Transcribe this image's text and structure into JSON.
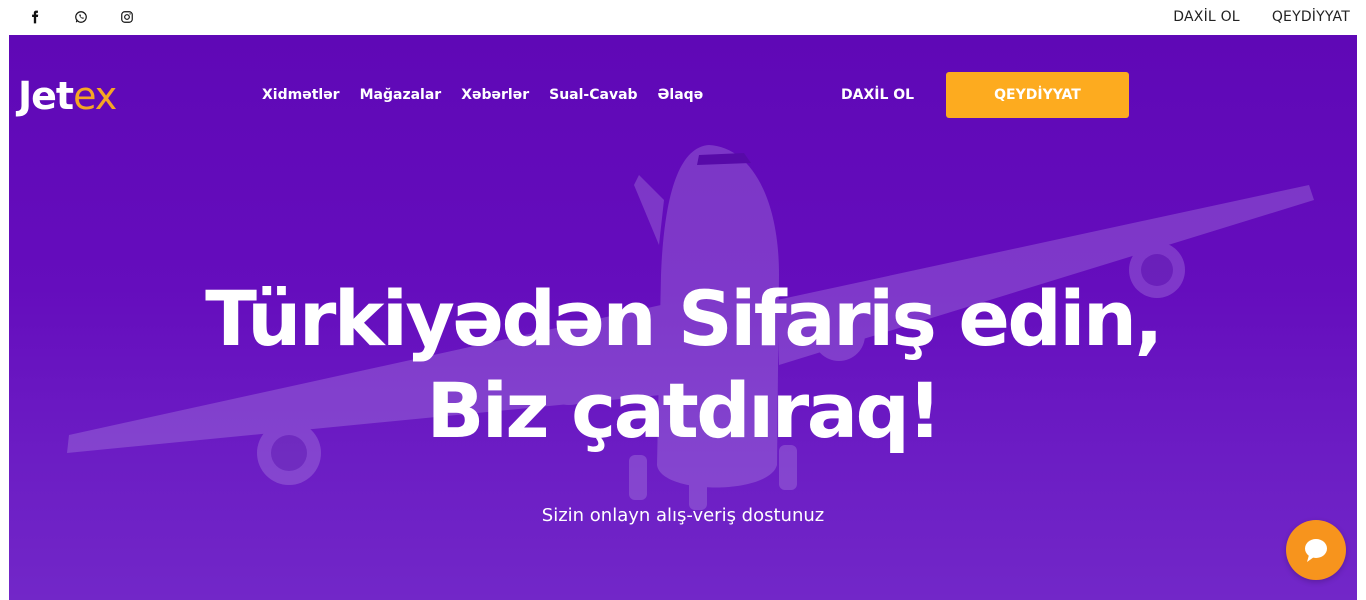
{
  "topbar": {
    "social_icons": [
      "facebook-icon",
      "whatsapp-icon",
      "instagram-icon"
    ],
    "login_label": "DAXİL OL",
    "register_label": "QEYDİYYAT"
  },
  "header": {
    "logo_part1": "Jet",
    "logo_part2": "ex",
    "nav": [
      "Xidmətlər",
      "Mağazalar",
      "Xəbərlər",
      "Sual-Cavab",
      "Əlaqə"
    ],
    "login_label": "DAXİL OL",
    "register_label": "QEYDİYYAT"
  },
  "hero": {
    "headline_line1": "Türkiyədən Sifariş edin,",
    "headline_line2": "Biz çatdıraq!",
    "subtitle": "Sizin onlayn alış-veriş dostunuz"
  },
  "chat": {
    "icon": "chat-bubble-icon"
  },
  "colors": {
    "hero_bg": "#650dbd",
    "accent": "#fdab1f",
    "logo_accent": "#f6a623",
    "chat_bg": "#f7941d"
  }
}
